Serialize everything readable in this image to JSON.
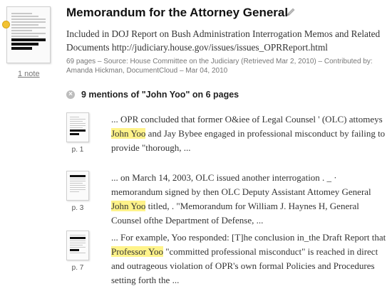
{
  "document": {
    "title": "Memorandum for the Attorney General",
    "description": "Included in DOJ Report on Bush Administration Interrogation Memos and Related Documents http://judiciary.house.gov/issues/issues_OPRReport.html",
    "meta": "69 pages – Source: House Committee on the Judiciary (Retrieved Mar 2, 2010) – Contributed by: Amanda Hickman, DocumentCloud – Mar 04, 2010",
    "notes_link": "1 note"
  },
  "search": {
    "mentions_label": "9 mentions of \"John Yoo\" on 6 pages"
  },
  "mentions": [
    {
      "page": "p. 1",
      "before": "... OPR concluded that former O&iee of Legal Counsel ' (OLC) attomeys ",
      "highlight": "John Yoo",
      "after": " and Jay Bybee engaged in professional misconduct by failing to provide \"thorough, ..."
    },
    {
      "page": "p. 3",
      "before": "... on March 14, 2003, OLC issued another interrogation . _ · memorandum signed by then OLC Deputy Assistant Attomey General ",
      "highlight": "John Yoo",
      "after": " titled, . \"Memorandum for William J. Haynes H, General Counsel ofthe Department of Defense, ..."
    },
    {
      "page": "p. 7",
      "before": "... For example, Yoo responded: [T]he conclusion in_the Draft Report that ",
      "highlight": "Professor Yoo",
      "after": " \"committed professional misconduct\" is reached in direct and outrageous violation of OPR's own formal Policies and Procedures setting forth the ..."
    }
  ],
  "colors": {
    "highlight": "#fff38a",
    "note_dot": "#f2c232"
  },
  "icons": {
    "edit": "pencil-icon",
    "clear": "close-icon"
  }
}
